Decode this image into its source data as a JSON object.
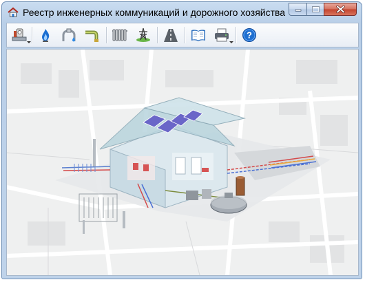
{
  "window": {
    "title": "Реестр инженерных коммуникаций и дорожного хозяйства"
  },
  "toolbar": {
    "buttons": [
      {
        "icon": "utility-meter-icon",
        "has_dropdown": true
      },
      {
        "icon": "gas-flame-icon",
        "has_dropdown": false
      },
      {
        "icon": "water-pipe-icon",
        "has_dropdown": false
      },
      {
        "icon": "drain-pipe-icon",
        "has_dropdown": false
      },
      {
        "icon": "heating-radiator-icon",
        "has_dropdown": false
      },
      {
        "icon": "power-tower-icon",
        "has_dropdown": false
      },
      {
        "icon": "road-icon",
        "has_dropdown": false
      },
      {
        "icon": "book-icon",
        "has_dropdown": false
      },
      {
        "icon": "printer-icon",
        "has_dropdown": true
      },
      {
        "icon": "help-icon",
        "has_dropdown": false
      }
    ]
  },
  "illustration": {
    "description_icon": "house-utilities-illustration"
  },
  "colors": {
    "accent_blue": "#1d6fd1",
    "close_red": "#c3432e",
    "map_background": "#eff0f0"
  }
}
